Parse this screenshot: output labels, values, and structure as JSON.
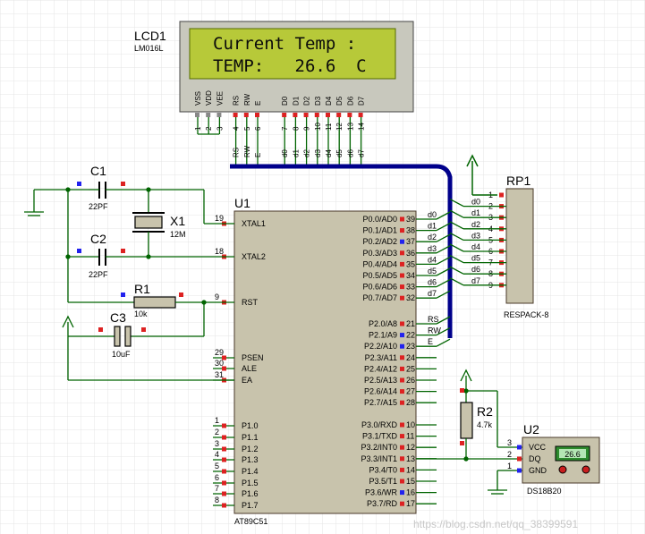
{
  "lcd": {
    "ref": "LCD1",
    "part": "LM016L",
    "line1": "Current Temp :",
    "line2": "TEMP:   26.6  C",
    "pins": [
      "VSS",
      "VDD",
      "VEE",
      "RS",
      "RW",
      "E",
      "D0",
      "D1",
      "D2",
      "D3",
      "D4",
      "D5",
      "D6",
      "D7"
    ],
    "pin_numbers": [
      "1",
      "2",
      "3",
      "4",
      "5",
      "6",
      "7",
      "8",
      "9",
      "10",
      "11",
      "12",
      "13",
      "14"
    ],
    "bus_labels": [
      "RS",
      "RW",
      "E",
      "d0",
      "d1",
      "d2",
      "d3",
      "d4",
      "d5",
      "d6",
      "d7"
    ]
  },
  "mcu": {
    "ref": "U1",
    "part": "AT89C51",
    "left_pins": [
      {
        "name": "XTAL1",
        "num": "19"
      },
      {
        "name": "XTAL2",
        "num": "18"
      },
      {
        "name": "RST",
        "num": "9"
      },
      {
        "name": "PSEN",
        "num": "29"
      },
      {
        "name": "ALE",
        "num": "30"
      },
      {
        "name": "EA",
        "num": "31"
      },
      {
        "name": "P1.0",
        "num": "1"
      },
      {
        "name": "P1.1",
        "num": "2"
      },
      {
        "name": "P1.2",
        "num": "3"
      },
      {
        "name": "P1.3",
        "num": "4"
      },
      {
        "name": "P1.4",
        "num": "5"
      },
      {
        "name": "P1.5",
        "num": "6"
      },
      {
        "name": "P1.6",
        "num": "7"
      },
      {
        "name": "P1.7",
        "num": "8"
      }
    ],
    "right_pins": [
      {
        "name": "P0.0/AD0",
        "num": "39",
        "net": "d0"
      },
      {
        "name": "P0.1/AD1",
        "num": "38",
        "net": "d1"
      },
      {
        "name": "P0.2/AD2",
        "num": "37",
        "net": "d2"
      },
      {
        "name": "P0.3/AD3",
        "num": "36",
        "net": "d3"
      },
      {
        "name": "P0.4/AD4",
        "num": "35",
        "net": "d4"
      },
      {
        "name": "P0.5/AD5",
        "num": "34",
        "net": "d5"
      },
      {
        "name": "P0.6/AD6",
        "num": "33",
        "net": "d6"
      },
      {
        "name": "P0.7/AD7",
        "num": "32",
        "net": "d7"
      },
      {
        "name": "P2.0/A8",
        "num": "21",
        "net": "RS"
      },
      {
        "name": "P2.1/A9",
        "num": "22",
        "net": "RW"
      },
      {
        "name": "P2.2/A10",
        "num": "23",
        "net": "E"
      },
      {
        "name": "P2.3/A11",
        "num": "24",
        "net": ""
      },
      {
        "name": "P2.4/A12",
        "num": "25",
        "net": ""
      },
      {
        "name": "P2.5/A13",
        "num": "26",
        "net": ""
      },
      {
        "name": "P2.6/A14",
        "num": "27",
        "net": ""
      },
      {
        "name": "P2.7/A15",
        "num": "28",
        "net": ""
      },
      {
        "name": "P3.0/RXD",
        "num": "10",
        "net": ""
      },
      {
        "name": "P3.1/TXD",
        "num": "11",
        "net": ""
      },
      {
        "name": "P3.2/INT0",
        "num": "12",
        "net": ""
      },
      {
        "name": "P3.3/INT1",
        "num": "13",
        "net": ""
      },
      {
        "name": "P3.4/T0",
        "num": "14",
        "net": ""
      },
      {
        "name": "P3.5/T1",
        "num": "15",
        "net": ""
      },
      {
        "name": "P3.6/WR",
        "num": "16",
        "net": ""
      },
      {
        "name": "P3.7/RD",
        "num": "17",
        "net": ""
      }
    ]
  },
  "rp1": {
    "ref": "RP1",
    "part": "RESPACK-8",
    "pin_numbers": [
      "1",
      "2",
      "3",
      "4",
      "5",
      "6",
      "7",
      "8",
      "9"
    ],
    "nets": [
      "d0",
      "d1",
      "d2",
      "d3",
      "d4",
      "d5",
      "d6",
      "d7"
    ]
  },
  "passives": {
    "c1": {
      "ref": "C1",
      "value": "22PF"
    },
    "c2": {
      "ref": "C2",
      "value": "22PF"
    },
    "x1": {
      "ref": "X1",
      "value": "12M"
    },
    "r1": {
      "ref": "R1",
      "value": "10k"
    },
    "c3": {
      "ref": "C3",
      "value": "10uF"
    },
    "r2": {
      "ref": "R2",
      "value": "4.7k"
    }
  },
  "u2": {
    "ref": "U2",
    "part": "DS18B20",
    "reading": "26.6",
    "pins": [
      {
        "name": "VCC",
        "num": "3"
      },
      {
        "name": "DQ",
        "num": "2"
      },
      {
        "name": "GND",
        "num": "1"
      }
    ]
  },
  "watermark": "https://blog.csdn.net/qq_38399591"
}
